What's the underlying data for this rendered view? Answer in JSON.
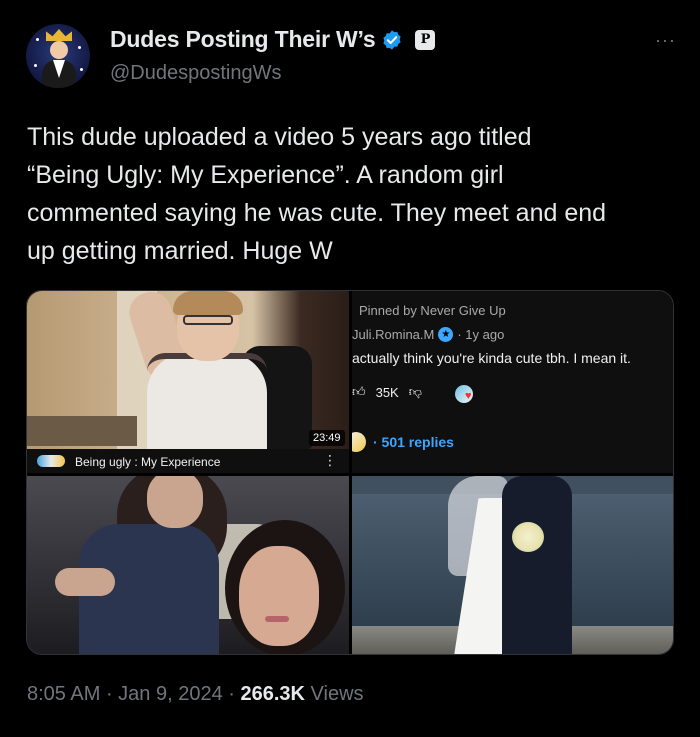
{
  "author": {
    "display_name": "Dudes Posting Their W’s",
    "handle": "@DudespostingWs",
    "verified_icon": "verified-check-icon",
    "badge_letter": "P",
    "more_label": "···"
  },
  "tweet": {
    "lines": [
      "This dude uploaded a video 5 years ago titled",
      "“Being Ugly: My Experience”. A random girl",
      "commented saying he was cute. They meet and end",
      "up getting married. Huge W"
    ]
  },
  "media": {
    "video": {
      "duration": "23:49",
      "title": "Being ugly : My Experience",
      "kebab": "⋮"
    },
    "comment": {
      "pinned": "Pinned by Never Give Up",
      "author": "Juli.Romina.M",
      "time": "· 1y ago",
      "text": "actually think you're kinda cute tbh. I mean it.",
      "likes": "35K",
      "replies": "· 501 replies"
    }
  },
  "footer": {
    "time": "8:05 AM",
    "sep1": " · ",
    "date": "Jan 9, 2024",
    "sep2": " · ",
    "views_count": "266.3K",
    "views_label": " Views"
  },
  "colors": {
    "background": "#000000",
    "text": "#e7e9ea",
    "muted": "#71767b",
    "verified_blue": "#1d9bf0",
    "youtube_link": "#3ea6ff"
  }
}
